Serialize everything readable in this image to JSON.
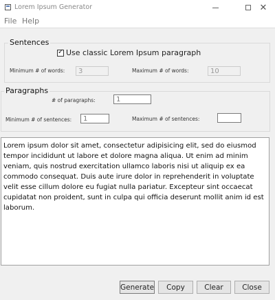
{
  "window": {
    "title": "Lorem Ipsum Generator"
  },
  "menu": {
    "items": [
      "File",
      "Help"
    ]
  },
  "sentences": {
    "group_title": "Sentences",
    "classic_checkbox_label": "Use classic Lorem Ipsum paragraph",
    "classic_checked": true,
    "min_words_label": "Minimum # of words:",
    "min_words_value": "3",
    "max_words_label": "Maximum # of words:",
    "max_words_value": "10"
  },
  "paragraphs": {
    "group_title": "Paragraphs",
    "count_label": "# of paragraphs:",
    "count_value": "1",
    "min_sentences_label": "Minimum # of sentences:",
    "min_sentences_value": "1",
    "max_sentences_label": "Maximum # of sentences:",
    "max_sentences_value": ""
  },
  "output": {
    "text": "Lorem ipsum dolor sit amet, consectetur adipisicing elit, sed do eiusmod tempor incididunt ut labore et dolore magna aliqua.  Ut enim ad minim veniam, quis nostrud exercitation ullamco laboris nisi ut aliquip ex ea commodo consequat. Duis aute irure dolor in reprehenderit in voluptate velit esse cillum dolore eu fugiat nulla pariatur. Excepteur sint occaecat cupidatat non proident, sunt in culpa qui officia deserunt mollit anim id est laborum."
  },
  "buttons": {
    "generate": "Generate",
    "copy": "Copy",
    "clear": "Clear",
    "close": "Close"
  },
  "icons": {
    "app": "app-icon",
    "minimize": "minimize-icon",
    "maximize": "maximize-icon",
    "close": "close-icon",
    "check": "checkmark-icon"
  }
}
